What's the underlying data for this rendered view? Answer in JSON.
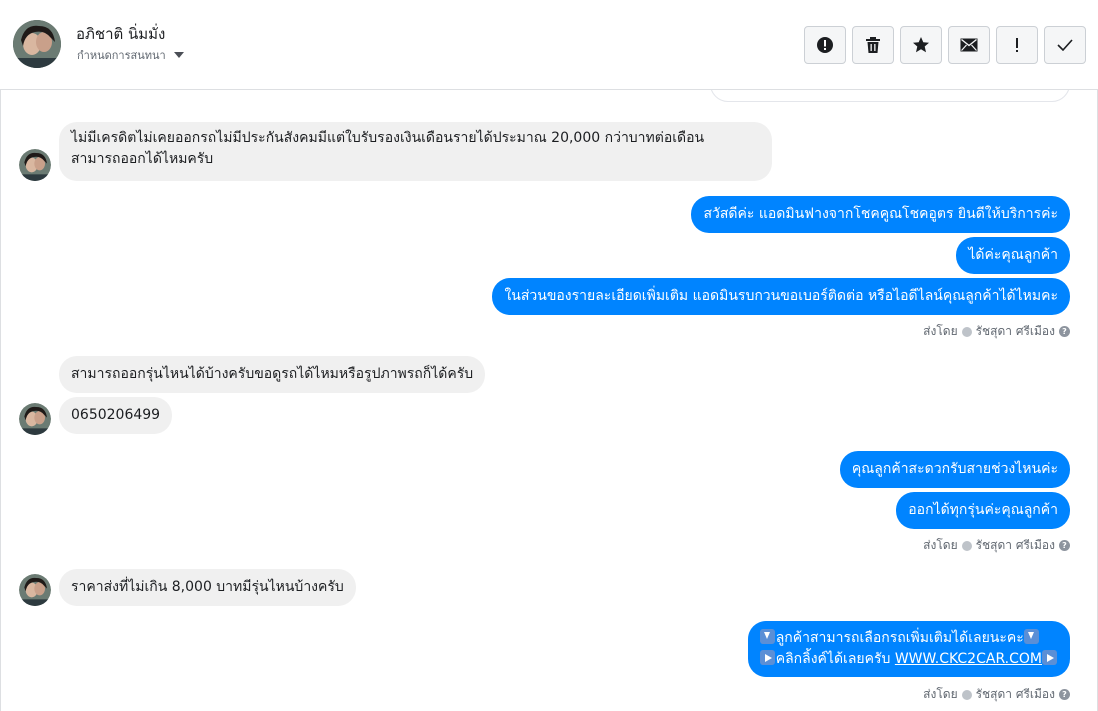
{
  "header": {
    "contact_name": "อภิชาติ นิ่มมั่ง",
    "assign_label": "กำหนดการสนทนา",
    "toolbar": [
      {
        "name": "spam-button",
        "icon": "alert-circle-icon"
      },
      {
        "name": "delete-button",
        "icon": "trash-icon"
      },
      {
        "name": "star-button",
        "icon": "star-icon"
      },
      {
        "name": "mark-unread-button",
        "icon": "envelope-icon"
      },
      {
        "name": "important-button",
        "icon": "exclamation-icon"
      },
      {
        "name": "done-button",
        "icon": "checkmark-icon"
      }
    ]
  },
  "messages": {
    "m1": "ไม่มีเครดิตไม่เคยออกรถไม่มีประกันสังคมมีแต่ใบรับรองเงินเดือนรายได้ประมาณ 20,000 กว่าบาทต่อเดือน",
    "m1b": "สามารถออกได้ไหมครับ",
    "m2": "สวัสดีค่ะ แอดมินฟางจากโชคคูณโชคอูตร ยินดีให้บริการค่ะ",
    "m3": "ได้ค่ะคุณลูกค้า",
    "m4": "ในส่วนของรายละเอียดเพิ่มเติม แอดมินรบกวนขอเบอร์ติดต่อ หรือไอดีไลน์คุณลูกค้าได้ไหมคะ",
    "m5": "สามารถออกรุ่นไหนได้บ้างครับขอดูรถได้ไหมหรือรูปภาพรถก็ได้ครับ",
    "m6": "0650206499",
    "m7": "คุณลูกค้าสะดวกรับสายช่วงไหนค่ะ",
    "m8": "ออกได้ทุกรุ่นค่ะคุณลูกค้า",
    "m9": "ราคาส่งที่ไม่เกิน 8,000 บาทมีรุ่นไหนบ้างครับ",
    "m10a": "ลูกค้าสามารถเลือกรถเพิ่มเติมได้เลยนะคะ",
    "m10b": "คลิกลิ้งค์ได้เลยครับ",
    "m10_link": "WWW.CKC2CAR.COM"
  },
  "sent_by": {
    "prefix": "ส่งโดย",
    "agent": "รัชสุดา ศรีเมือง"
  },
  "colors": {
    "outgoing": "#0084ff",
    "incoming": "#f0f0f0"
  }
}
